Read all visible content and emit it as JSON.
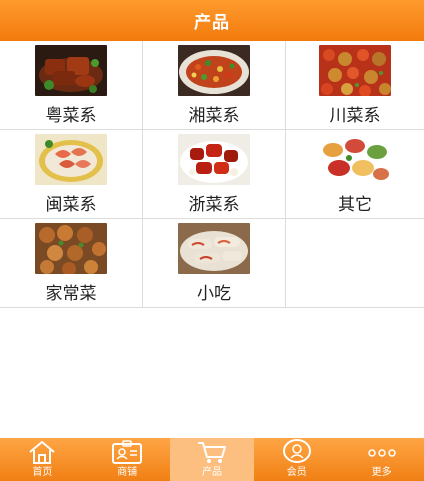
{
  "header": {
    "title": "产品"
  },
  "categories": [
    {
      "label": "粤菜系",
      "image": "braised-pork-dish"
    },
    {
      "label": "湘菜系",
      "image": "spicy-chili-fish-dish"
    },
    {
      "label": "川菜系",
      "image": "dry-chili-chicken-dish"
    },
    {
      "label": "闽菜系",
      "image": "shrimp-platter-dish"
    },
    {
      "label": "浙菜系",
      "image": "sweet-sour-ribs-dish"
    },
    {
      "label": "其它",
      "image": "mixed-dim-sum-dish"
    },
    {
      "label": "家常菜",
      "image": "stir-fry-meat-dish"
    },
    {
      "label": "小吃",
      "image": "rice-noodle-rolls-dish"
    }
  ],
  "tabbar": {
    "items": [
      {
        "label": "首页",
        "icon": "home-icon"
      },
      {
        "label": "商铺",
        "icon": "shop-id-card-icon"
      },
      {
        "label": "产品",
        "icon": "shopping-cart-icon"
      },
      {
        "label": "会员",
        "icon": "member-icon"
      },
      {
        "label": "更多",
        "icon": "more-dots-icon"
      }
    ],
    "active": "产品"
  },
  "colors": {
    "accent": "#f58a1f",
    "active_tab": "#fcbf80",
    "divider": "#dcdcdc"
  }
}
